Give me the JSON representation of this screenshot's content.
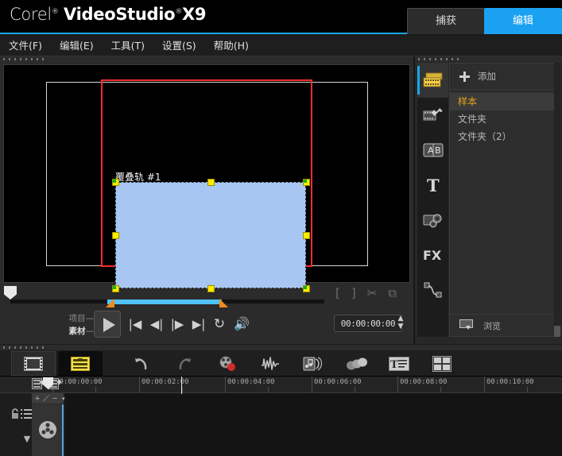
{
  "app": {
    "brand_prefix": "Corel",
    "brand_sup": "®",
    "brand_main": "VideoStudio",
    "brand_sup2": "®",
    "brand_version": "X9",
    "accent_color": "#1ba1f2",
    "titlebar_underline": "#19a7e8"
  },
  "tabs": [
    {
      "label": "捕获",
      "active": false,
      "name": "tab-capture"
    },
    {
      "label": "编辑",
      "active": true,
      "name": "tab-edit"
    }
  ],
  "menubar": [
    {
      "label": "文件(F)",
      "name": "menu-file"
    },
    {
      "label": "编辑(E)",
      "name": "menu-edit"
    },
    {
      "label": "工具(T)",
      "name": "menu-tools"
    },
    {
      "label": "设置(S)",
      "name": "menu-settings"
    },
    {
      "label": "帮助(H)",
      "name": "menu-help"
    }
  ],
  "preview": {
    "overlay_label": "覆叠轨 #1",
    "overlay_fill": "#a7c7f2",
    "crop_border_color": "#f42c2c",
    "handle_color": "#ffea00",
    "handle_pivot_color": "#12b312",
    "trim_bar_color": "#4fc3f7",
    "trim_handle_color": "#f08a1e",
    "nav_icons": [
      {
        "glyph": "[",
        "name": "mark-in-icon"
      },
      {
        "glyph": "]",
        "name": "mark-out-icon"
      },
      {
        "glyph": "✂",
        "name": "split-clip-icon"
      },
      {
        "glyph": "⧉",
        "name": "enlarge-preview-icon"
      }
    ]
  },
  "playback": {
    "project_label": "项目",
    "clip_label": "素材",
    "dash": "—",
    "timecode": "00:00:00:00",
    "buttons": [
      {
        "glyph": "▶",
        "name": "play-button"
      },
      {
        "glyph": "|◀",
        "name": "home-button"
      },
      {
        "glyph": "◀|",
        "name": "previous-frame-button"
      },
      {
        "glyph": "|▶",
        "name": "next-frame-button"
      },
      {
        "glyph": "▶|",
        "name": "end-button"
      },
      {
        "glyph": "↻",
        "name": "repeat-button"
      },
      {
        "glyph": "🔊",
        "name": "volume-button"
      }
    ]
  },
  "library": {
    "rail": [
      {
        "name": "media-icon",
        "active": true
      },
      {
        "name": "instant-project-icon",
        "active": false
      },
      {
        "name": "transition-ab-icon",
        "active": false
      },
      {
        "name": "title-t-icon",
        "active": false
      },
      {
        "name": "graphic-icon",
        "active": false
      },
      {
        "name": "filter-fx-icon",
        "active": false
      },
      {
        "name": "path-icon",
        "active": false
      }
    ],
    "add_label": "添加",
    "browse_label": "浏览",
    "items": [
      {
        "label": "样本",
        "selected": true
      },
      {
        "label": "文件夹",
        "selected": false
      },
      {
        "label": "文件夹（2）",
        "selected": false
      }
    ]
  },
  "timeline": {
    "mode_buttons": [
      {
        "name": "storyboard-view-button",
        "active": false
      },
      {
        "name": "timeline-view-button",
        "active": true
      }
    ],
    "tool_buttons": [
      {
        "name": "undo-icon"
      },
      {
        "name": "redo-icon"
      },
      {
        "name": "record-capture-icon"
      },
      {
        "name": "audio-mixer-icon"
      },
      {
        "name": "auto-music-icon"
      },
      {
        "name": "motion-tracking-icon"
      },
      {
        "name": "subtitle-editor-icon"
      },
      {
        "name": "multi-trim-icon"
      }
    ],
    "ruler_labels": [
      "00:00:00:00",
      "00:00:02:00",
      "00:00:04:00",
      "00:00:06:00",
      "00:00:08:00",
      "00:00:10:00"
    ],
    "track_header_controls": [
      "＋",
      "／",
      "－",
      "▾"
    ],
    "playhead_timecode": "00:00:00:00"
  }
}
